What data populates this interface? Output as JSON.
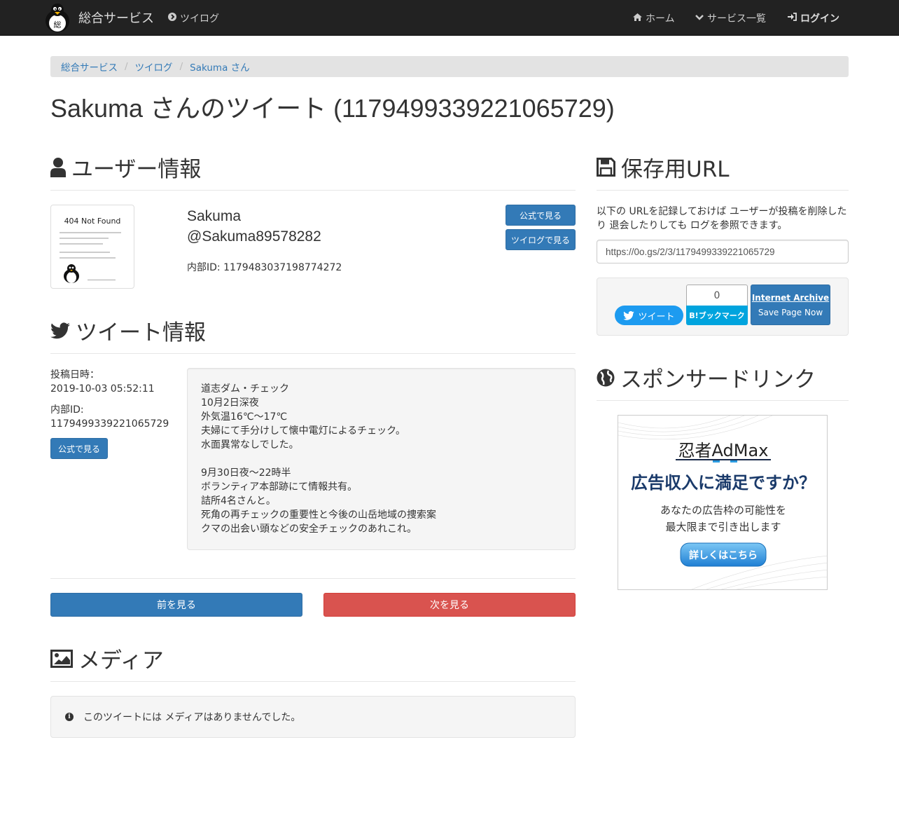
{
  "navbar": {
    "brand": "総合サービス",
    "twilog_link": "ツイログ",
    "home": "ホーム",
    "services": "サービス一覧",
    "login": "ログイン"
  },
  "breadcrumb": [
    "総合サービス",
    "ツイログ",
    "Sakuma さん"
  ],
  "page_title": "Sakuma さんのツイート (1179499339221065729)",
  "user_section": {
    "heading": "ユーザー情報",
    "avatar_text": "404 Not Found",
    "name": "Sakuma",
    "handle": "@Sakuma89578282",
    "internal_id": "内部ID: 1179483037198774272",
    "btn_official": "公式で見る",
    "btn_twilog": "ツイログで見る"
  },
  "tweet_section": {
    "heading": "ツイート情報",
    "posted_label": "投稿日時：",
    "posted_value": "2019-10-03 05:52:11",
    "id_label": "内部ID:",
    "id_value": "1179499339221065729",
    "btn_official": "公式で見る",
    "lines": [
      "道志ダム・チェック",
      "10月2日深夜",
      "外気温16℃～17℃",
      "夫婦にて手分けして懐中電灯によるチェック。",
      "水面異常なしでした。",
      "",
      "9月30日夜～22時半",
      "ボランティア本部跡にて情報共有。",
      "詰所4名さんと。",
      "死角の再チェックの重要性と今後の山岳地域の捜索案",
      "クマの出会い頭などの安全チェックのあれこれ。"
    ]
  },
  "pager": {
    "prev": "前を見る",
    "next": "次を見る"
  },
  "media_section": {
    "heading": "メディア",
    "message": "このツイートには メディアはありませんでした。"
  },
  "save_section": {
    "heading": "保存用URL",
    "description": "以下の URLを記録しておけば ユーザーが投稿を削除したり 退会したりしても ログを参照できます。",
    "url": "https://0o.gs/2/3/1179499339221065729",
    "tweet_btn": "ツイート",
    "hatena_count": "0",
    "hatena_btn": "B!ブックマーク",
    "ia_title": "Internet Archive",
    "ia_sub": "Save Page Now"
  },
  "sponsor_section": {
    "heading": "スポンサードリンク",
    "ad_brand": "忍者AdMax",
    "ad_headline": "広告収入に満足ですか？",
    "ad_body1": "あなたの広告枠の可能性を",
    "ad_body2": "最大限まで引き出します",
    "ad_cta": "詳しくはこちら"
  },
  "colors": {
    "navbar": "#222222",
    "primary": "#337ab7",
    "danger": "#d9534f",
    "twitter": "#1d9bf0",
    "hatena": "#00a4de"
  }
}
